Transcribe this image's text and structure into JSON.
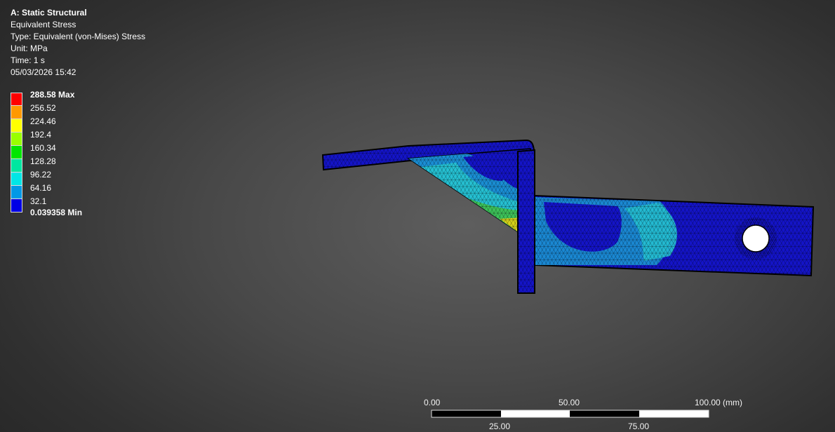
{
  "header": {
    "title": "A: Static Structural",
    "result_name": "Equivalent Stress",
    "type_line": "Type: Equivalent (von-Mises) Stress",
    "unit_line": "Unit: MPa",
    "time_line": "Time: 1 s",
    "date_line": "05/03/2026 15:42"
  },
  "legend": {
    "max_label": "288.58 Max",
    "min_label": "0.039358 Min",
    "values": [
      "256.52",
      "224.46",
      "192.4",
      "160.34",
      "128.28",
      "96.22",
      "64.16",
      "32.1"
    ],
    "colors": [
      "#ff0000",
      "#ff9900",
      "#ffff00",
      "#99ff00",
      "#00e600",
      "#00e6a0",
      "#00e6e6",
      "#0099e6",
      "#0000e6"
    ]
  },
  "scale_bar": {
    "label_0": "0.00",
    "label_50": "50.00",
    "label_100": "100.00 (mm)",
    "label_25": "25.00",
    "label_75": "75.00"
  },
  "model": {
    "colors": {
      "low": "#1414c8",
      "low_mid": "#1a8ed4",
      "mid": "#25c0d2",
      "high": "#3dc25a",
      "peak": "#d6d21a",
      "edge": "#000000"
    }
  }
}
